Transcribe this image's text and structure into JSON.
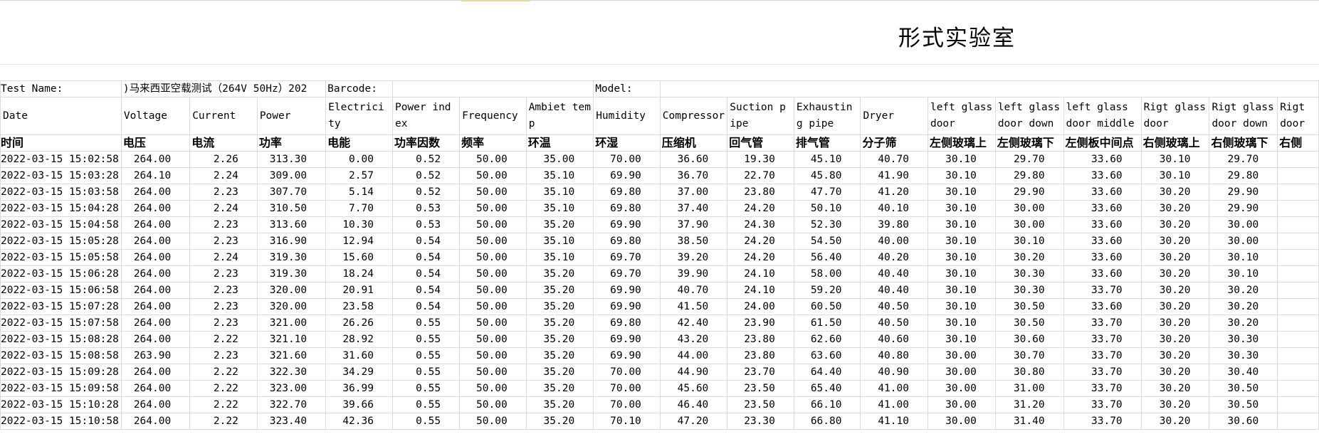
{
  "sheet": {
    "title": "形式实验室",
    "meta": {
      "test_name_label": "Test Name:",
      "test_name_value": ")马来西亚空载测试（264V 50Hz）202",
      "barcode_label": "Barcode:",
      "model_label": "Model:"
    },
    "headers_en": [
      "Date",
      "Voltage",
      "Current",
      "Power",
      "Electricity",
      "Power index",
      "Frequency",
      "Ambiet temp",
      "Humidity",
      "Compressor",
      "Suction pipe",
      "Exhausting pipe",
      "Dryer",
      "left glass door",
      "left glass door down",
      "left glass door middle",
      "Rigt glass door",
      "Rigt glass door down",
      "Rigt door"
    ],
    "headers_cn": [
      "时间",
      "电压",
      "电流",
      "功率",
      "电能",
      "功率因数",
      "频率",
      "环温",
      "环湿",
      "压缩机",
      "回气管",
      "排气管",
      "分子筛",
      "左侧玻璃上",
      "左侧玻璃下",
      "左侧板中间点",
      "右侧玻璃上",
      "右侧玻璃下",
      "右侧"
    ],
    "rows": [
      [
        "2022-03-15 15:02:58",
        "264.00",
        "2.26",
        "313.30",
        "0.00",
        "0.52",
        "50.00",
        "35.00",
        "70.00",
        "36.60",
        "19.30",
        "45.10",
        "40.70",
        "30.10",
        "29.70",
        "33.60",
        "30.10",
        "29.70",
        ""
      ],
      [
        "2022-03-15 15:03:28",
        "264.10",
        "2.24",
        "309.00",
        "2.57",
        "0.52",
        "50.00",
        "35.10",
        "69.90",
        "36.70",
        "22.70",
        "45.80",
        "41.90",
        "30.10",
        "29.80",
        "33.60",
        "30.10",
        "29.80",
        ""
      ],
      [
        "2022-03-15 15:03:58",
        "264.00",
        "2.23",
        "307.70",
        "5.14",
        "0.52",
        "50.00",
        "35.10",
        "69.80",
        "37.00",
        "23.80",
        "47.70",
        "41.20",
        "30.10",
        "29.90",
        "33.60",
        "30.20",
        "29.90",
        ""
      ],
      [
        "2022-03-15 15:04:28",
        "264.00",
        "2.24",
        "310.50",
        "7.70",
        "0.53",
        "50.00",
        "35.10",
        "69.80",
        "37.40",
        "24.20",
        "50.10",
        "40.10",
        "30.10",
        "30.00",
        "33.60",
        "30.20",
        "29.90",
        ""
      ],
      [
        "2022-03-15 15:04:58",
        "264.00",
        "2.23",
        "313.60",
        "10.30",
        "0.53",
        "50.00",
        "35.20",
        "69.90",
        "37.90",
        "24.30",
        "52.30",
        "39.80",
        "30.10",
        "30.00",
        "33.60",
        "30.20",
        "30.00",
        ""
      ],
      [
        "2022-03-15 15:05:28",
        "264.00",
        "2.23",
        "316.90",
        "12.94",
        "0.54",
        "50.00",
        "35.10",
        "69.80",
        "38.50",
        "24.20",
        "54.50",
        "40.00",
        "30.10",
        "30.10",
        "33.60",
        "30.20",
        "30.00",
        ""
      ],
      [
        "2022-03-15 15:05:58",
        "264.00",
        "2.24",
        "319.30",
        "15.60",
        "0.54",
        "50.00",
        "35.10",
        "69.70",
        "39.20",
        "24.20",
        "56.40",
        "40.20",
        "30.10",
        "30.20",
        "33.60",
        "30.20",
        "30.10",
        ""
      ],
      [
        "2022-03-15 15:06:28",
        "264.00",
        "2.23",
        "319.30",
        "18.24",
        "0.54",
        "50.00",
        "35.20",
        "69.70",
        "39.90",
        "24.10",
        "58.00",
        "40.40",
        "30.10",
        "30.30",
        "33.60",
        "30.20",
        "30.10",
        ""
      ],
      [
        "2022-03-15 15:06:58",
        "264.00",
        "2.23",
        "320.00",
        "20.91",
        "0.54",
        "50.00",
        "35.20",
        "69.90",
        "40.70",
        "24.10",
        "59.20",
        "40.40",
        "30.10",
        "30.30",
        "33.70",
        "30.20",
        "30.20",
        ""
      ],
      [
        "2022-03-15 15:07:28",
        "264.00",
        "2.23",
        "320.00",
        "23.58",
        "0.54",
        "50.00",
        "35.20",
        "69.90",
        "41.50",
        "24.00",
        "60.50",
        "40.50",
        "30.10",
        "30.50",
        "33.60",
        "30.20",
        "30.20",
        ""
      ],
      [
        "2022-03-15 15:07:58",
        "264.00",
        "2.23",
        "321.00",
        "26.26",
        "0.55",
        "50.00",
        "35.20",
        "69.80",
        "42.40",
        "23.90",
        "61.50",
        "40.50",
        "30.10",
        "30.50",
        "33.70",
        "30.20",
        "30.20",
        ""
      ],
      [
        "2022-03-15 15:08:28",
        "264.00",
        "2.22",
        "321.10",
        "28.92",
        "0.55",
        "50.00",
        "35.20",
        "69.90",
        "43.20",
        "23.80",
        "62.60",
        "40.60",
        "30.10",
        "30.60",
        "33.70",
        "30.20",
        "30.30",
        ""
      ],
      [
        "2022-03-15 15:08:58",
        "263.90",
        "2.23",
        "321.60",
        "31.60",
        "0.55",
        "50.00",
        "35.20",
        "69.90",
        "44.00",
        "23.80",
        "63.60",
        "40.80",
        "30.00",
        "30.70",
        "33.70",
        "30.20",
        "30.30",
        ""
      ],
      [
        "2022-03-15 15:09:28",
        "264.00",
        "2.22",
        "322.30",
        "34.29",
        "0.55",
        "50.00",
        "35.20",
        "70.00",
        "44.90",
        "23.70",
        "64.40",
        "40.90",
        "30.00",
        "30.80",
        "33.70",
        "30.20",
        "30.40",
        ""
      ],
      [
        "2022-03-15 15:09:58",
        "264.00",
        "2.22",
        "323.00",
        "36.99",
        "0.55",
        "50.00",
        "35.20",
        "70.00",
        "45.60",
        "23.50",
        "65.40",
        "41.00",
        "30.00",
        "31.00",
        "33.70",
        "30.20",
        "30.50",
        ""
      ],
      [
        "2022-03-15 15:10:28",
        "264.00",
        "2.22",
        "322.70",
        "39.66",
        "0.55",
        "50.00",
        "35.20",
        "70.00",
        "46.40",
        "23.50",
        "66.10",
        "41.00",
        "30.00",
        "31.20",
        "33.70",
        "30.20",
        "30.50",
        ""
      ],
      [
        "2022-03-15 15:10:58",
        "264.00",
        "2.22",
        "323.40",
        "42.36",
        "0.55",
        "50.00",
        "35.20",
        "70.10",
        "47.20",
        "23.30",
        "66.80",
        "41.10",
        "30.00",
        "31.40",
        "33.70",
        "30.20",
        "30.60",
        ""
      ]
    ]
  }
}
